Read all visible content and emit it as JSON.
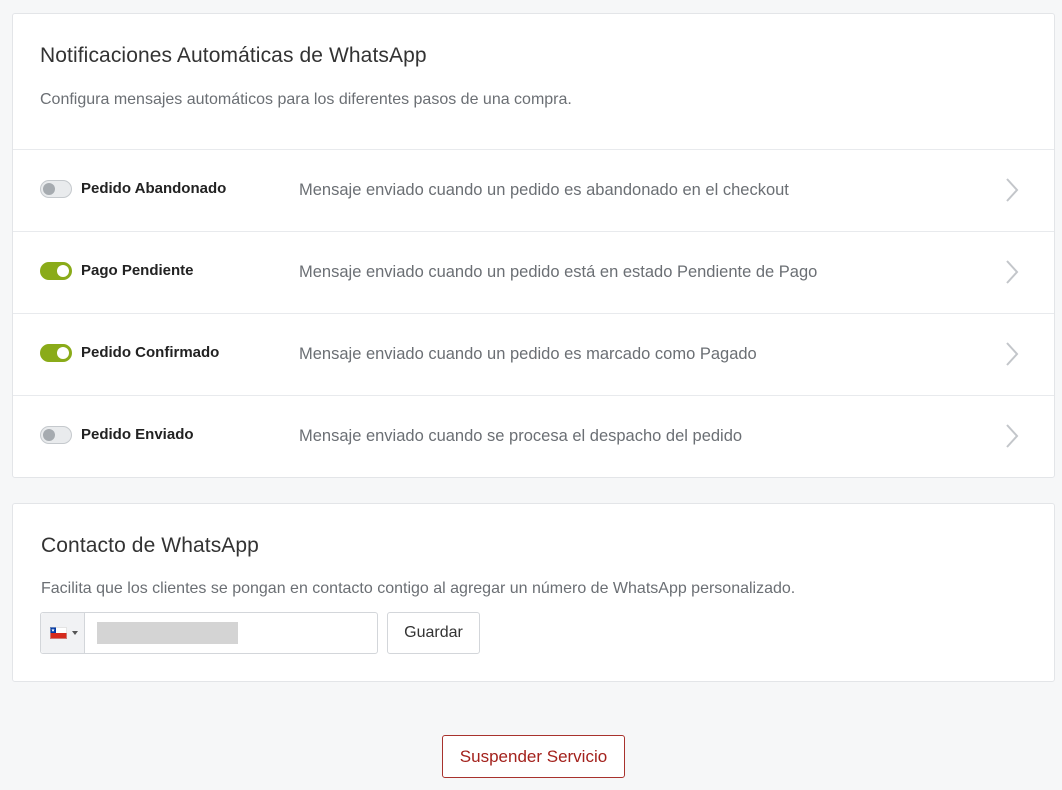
{
  "notifications": {
    "title": "Notificaciones Automáticas de WhatsApp",
    "subtitle": "Configura mensajes automáticos para los diferentes pasos de una compra.",
    "items": [
      {
        "label": "Pedido Abandonado",
        "description": "Mensaje enviado cuando un pedido es abandonado en el checkout",
        "enabled": false
      },
      {
        "label": "Pago Pendiente",
        "description": "Mensaje enviado cuando un pedido está en estado Pendiente de Pago",
        "enabled": true
      },
      {
        "label": "Pedido Confirmado",
        "description": "Mensaje enviado cuando un pedido es marcado como Pagado",
        "enabled": true
      },
      {
        "label": "Pedido Enviado",
        "description": "Mensaje enviado cuando se procesa el despacho del pedido",
        "enabled": false
      }
    ]
  },
  "contact": {
    "title": "Contacto de WhatsApp",
    "subtitle": "Facilita que los clientes se pongan en contacto contigo al agregar un número de WhatsApp personalizado.",
    "phone_value": "",
    "country_flag": "chile-flag-icon",
    "save_label": "Guardar"
  },
  "footer": {
    "suspend_label": "Suspender Servicio"
  },
  "colors": {
    "toggle_on": "#8aab19",
    "danger": "#a3211c"
  }
}
